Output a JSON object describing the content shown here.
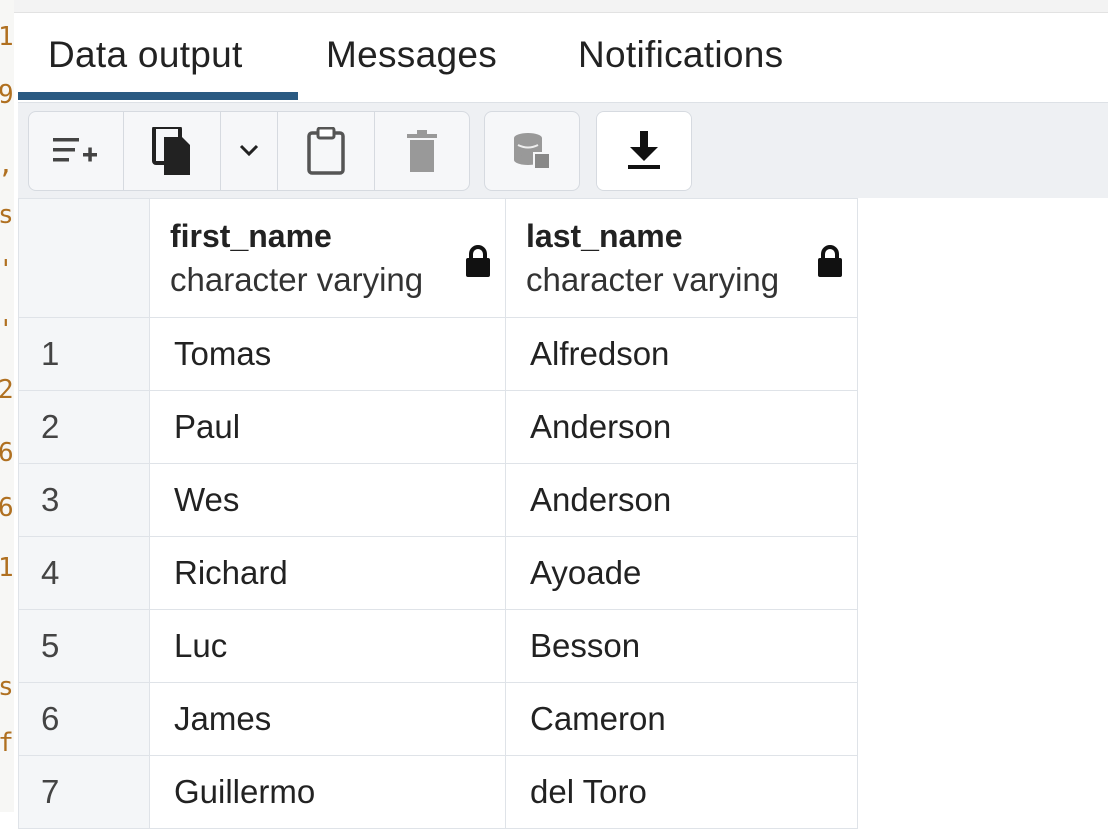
{
  "tabs": [
    {
      "label": "Data output",
      "active": true
    },
    {
      "label": "Messages",
      "active": false
    },
    {
      "label": "Notifications",
      "active": false
    }
  ],
  "toolbar": {
    "buttons": [
      {
        "icon": "add-row-icon"
      },
      {
        "icon": "copy-icon"
      },
      {
        "icon": "chevron-down-icon"
      },
      {
        "icon": "paste-icon"
      },
      {
        "icon": "delete-icon"
      },
      {
        "icon": "save-data-icon"
      },
      {
        "icon": "download-icon"
      }
    ]
  },
  "grid": {
    "columns": [
      {
        "name": "first_name",
        "type": "character varying",
        "icon": "lock-icon"
      },
      {
        "name": "last_name",
        "type": "character varying",
        "icon": "lock-icon"
      }
    ],
    "rows": [
      {
        "num": "1",
        "first_name": "Tomas",
        "last_name": "Alfredson"
      },
      {
        "num": "2",
        "first_name": "Paul",
        "last_name": "Anderson"
      },
      {
        "num": "3",
        "first_name": "Wes",
        "last_name": "Anderson"
      },
      {
        "num": "4",
        "first_name": "Richard",
        "last_name": "Ayoade"
      },
      {
        "num": "5",
        "first_name": "Luc",
        "last_name": "Besson"
      },
      {
        "num": "6",
        "first_name": "James",
        "last_name": "Cameron"
      },
      {
        "num": "7",
        "first_name": "Guillermo",
        "last_name": "del Toro"
      }
    ]
  },
  "colors": {
    "accent": "#2a5a82",
    "border": "#dfe3e8",
    "toolbar_bg": "#eef0f3"
  }
}
